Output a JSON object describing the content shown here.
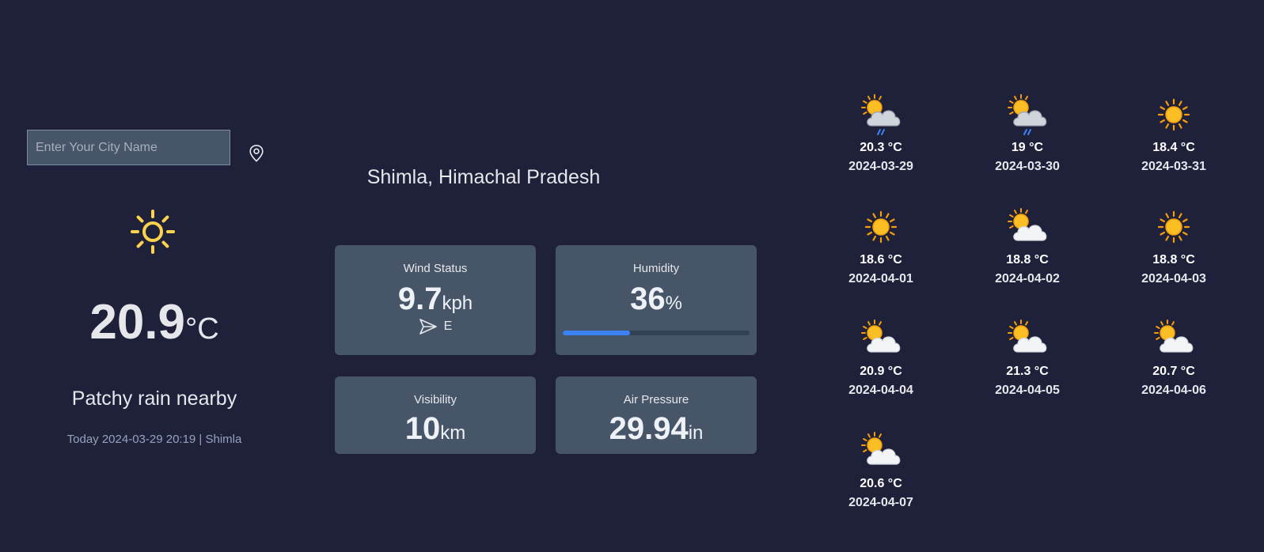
{
  "search": {
    "placeholder": "Enter Your City Name",
    "value": ""
  },
  "current": {
    "temp": "20.9",
    "unit": "°C",
    "condition": "Patchy rain nearby",
    "dateline": "Today 2024-03-29 20:19 | Shimla",
    "icon": "sun-outline-icon",
    "icon_color": "#fcd34d"
  },
  "location": "Shimla, Himachal Pradesh",
  "highlights": {
    "wind": {
      "label": "Wind Status",
      "value": "9.7",
      "unit": "kph",
      "direction": "E"
    },
    "humidity": {
      "label": "Humidity",
      "value": "36",
      "unit": "%",
      "percent": 36,
      "bar_color": "#3b82f6"
    },
    "visibility": {
      "label": "Visibility",
      "value": "10",
      "unit": "km"
    },
    "pressure": {
      "label": "Air Pressure",
      "value": "29.94",
      "unit": "in"
    }
  },
  "forecast": [
    {
      "temp": "20.3 °C",
      "date": "2024-03-29",
      "icon": "sun-cloud-rain-icon"
    },
    {
      "temp": "19 °C",
      "date": "2024-03-30",
      "icon": "sun-cloud-rain-icon"
    },
    {
      "temp": "18.4 °C",
      "date": "2024-03-31",
      "icon": "sun-icon"
    },
    {
      "temp": "18.6 °C",
      "date": "2024-04-01",
      "icon": "sun-icon"
    },
    {
      "temp": "18.8 °C",
      "date": "2024-04-02",
      "icon": "sun-cloud-icon"
    },
    {
      "temp": "18.8 °C",
      "date": "2024-04-03",
      "icon": "sun-icon"
    },
    {
      "temp": "20.9 °C",
      "date": "2024-04-04",
      "icon": "sun-cloud-icon"
    },
    {
      "temp": "21.3 °C",
      "date": "2024-04-05",
      "icon": "sun-cloud-icon"
    },
    {
      "temp": "20.7 °C",
      "date": "2024-04-06",
      "icon": "sun-cloud-icon"
    },
    {
      "temp": "20.6 °C",
      "date": "2024-04-07",
      "icon": "sun-cloud-icon"
    }
  ],
  "colors": {
    "background": "#1f213b",
    "card": "#475569",
    "accent": "#3b82f6"
  }
}
